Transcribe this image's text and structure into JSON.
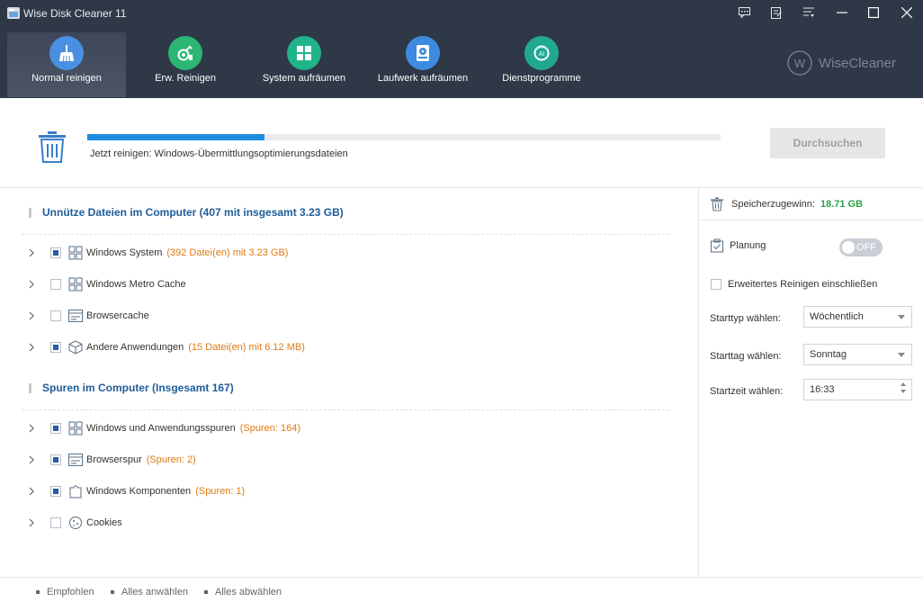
{
  "window": {
    "title": "Wise Disk Cleaner 11"
  },
  "nav": {
    "items": [
      {
        "label": "Normal reinigen",
        "icon": "broom-icon",
        "color": "#4a90e2"
      },
      {
        "label": "Erw. Reinigen",
        "icon": "advanced-clean-icon",
        "color": "#2bb673"
      },
      {
        "label": "System aufräumen",
        "icon": "windows-icon",
        "color": "#21b38a"
      },
      {
        "label": "Laufwerk aufräumen",
        "icon": "drive-icon",
        "color": "#3c8be0"
      },
      {
        "label": "Dienstprogramme",
        "icon": "toolbox-icon",
        "color": "#21a891"
      }
    ]
  },
  "brand": {
    "text": "WiseCleaner"
  },
  "progress": {
    "fraction": 0.28,
    "status": "Jetzt reinigen: Windows-Übermittlungsoptimierungsdateien",
    "button": "Durchsuchen"
  },
  "sections": [
    {
      "title": "Unnütze Dateien im Computer  (407 mit insgesamt 3.23 GB)",
      "items": [
        {
          "label": "Windows System",
          "count": "(392 Datei(en) mit 3.23 GB)",
          "checked": true,
          "icon": "windows-icon"
        },
        {
          "label": "Windows Metro Cache",
          "count": "",
          "checked": false,
          "icon": "windows-icon"
        },
        {
          "label": "Browsercache",
          "count": "",
          "checked": false,
          "icon": "browser-icon"
        },
        {
          "label": "Andere Anwendungen",
          "count": "(15 Datei(en) mit 6.12 MB)",
          "checked": true,
          "icon": "box-icon"
        }
      ]
    },
    {
      "title": "Spuren im Computer  (Insgesamt 167)",
      "items": [
        {
          "label": "Windows und Anwendungsspuren",
          "count": "(Spuren: 164)",
          "checked": true,
          "icon": "windows-icon"
        },
        {
          "label": "Browserspur",
          "count": "(Spuren: 2)",
          "checked": true,
          "icon": "browser-icon"
        },
        {
          "label": "Windows Komponenten",
          "count": "(Spuren: 1)",
          "checked": true,
          "icon": "puzzle-icon"
        },
        {
          "label": "Cookies",
          "count": "",
          "checked": false,
          "icon": "cookie-icon"
        }
      ]
    }
  ],
  "right": {
    "gain_label": "Speicherzugewinn:",
    "gain_value": "18.71 GB",
    "plan_label": "Planung",
    "toggle_text": "OFF",
    "extended_label": "Erweitertes Reinigen einschließen",
    "start_type_label": "Starttyp wählen:",
    "start_type_value": "Wöchentlich",
    "start_day_label": "Starttag wählen:",
    "start_day_value": "Sonntag",
    "start_time_label": "Startzeit wählen:",
    "start_time_value": "16:33"
  },
  "footer": {
    "recommended": "Empfohlen",
    "select_all": "Alles anwählen",
    "deselect_all": "Alles abwählen"
  }
}
